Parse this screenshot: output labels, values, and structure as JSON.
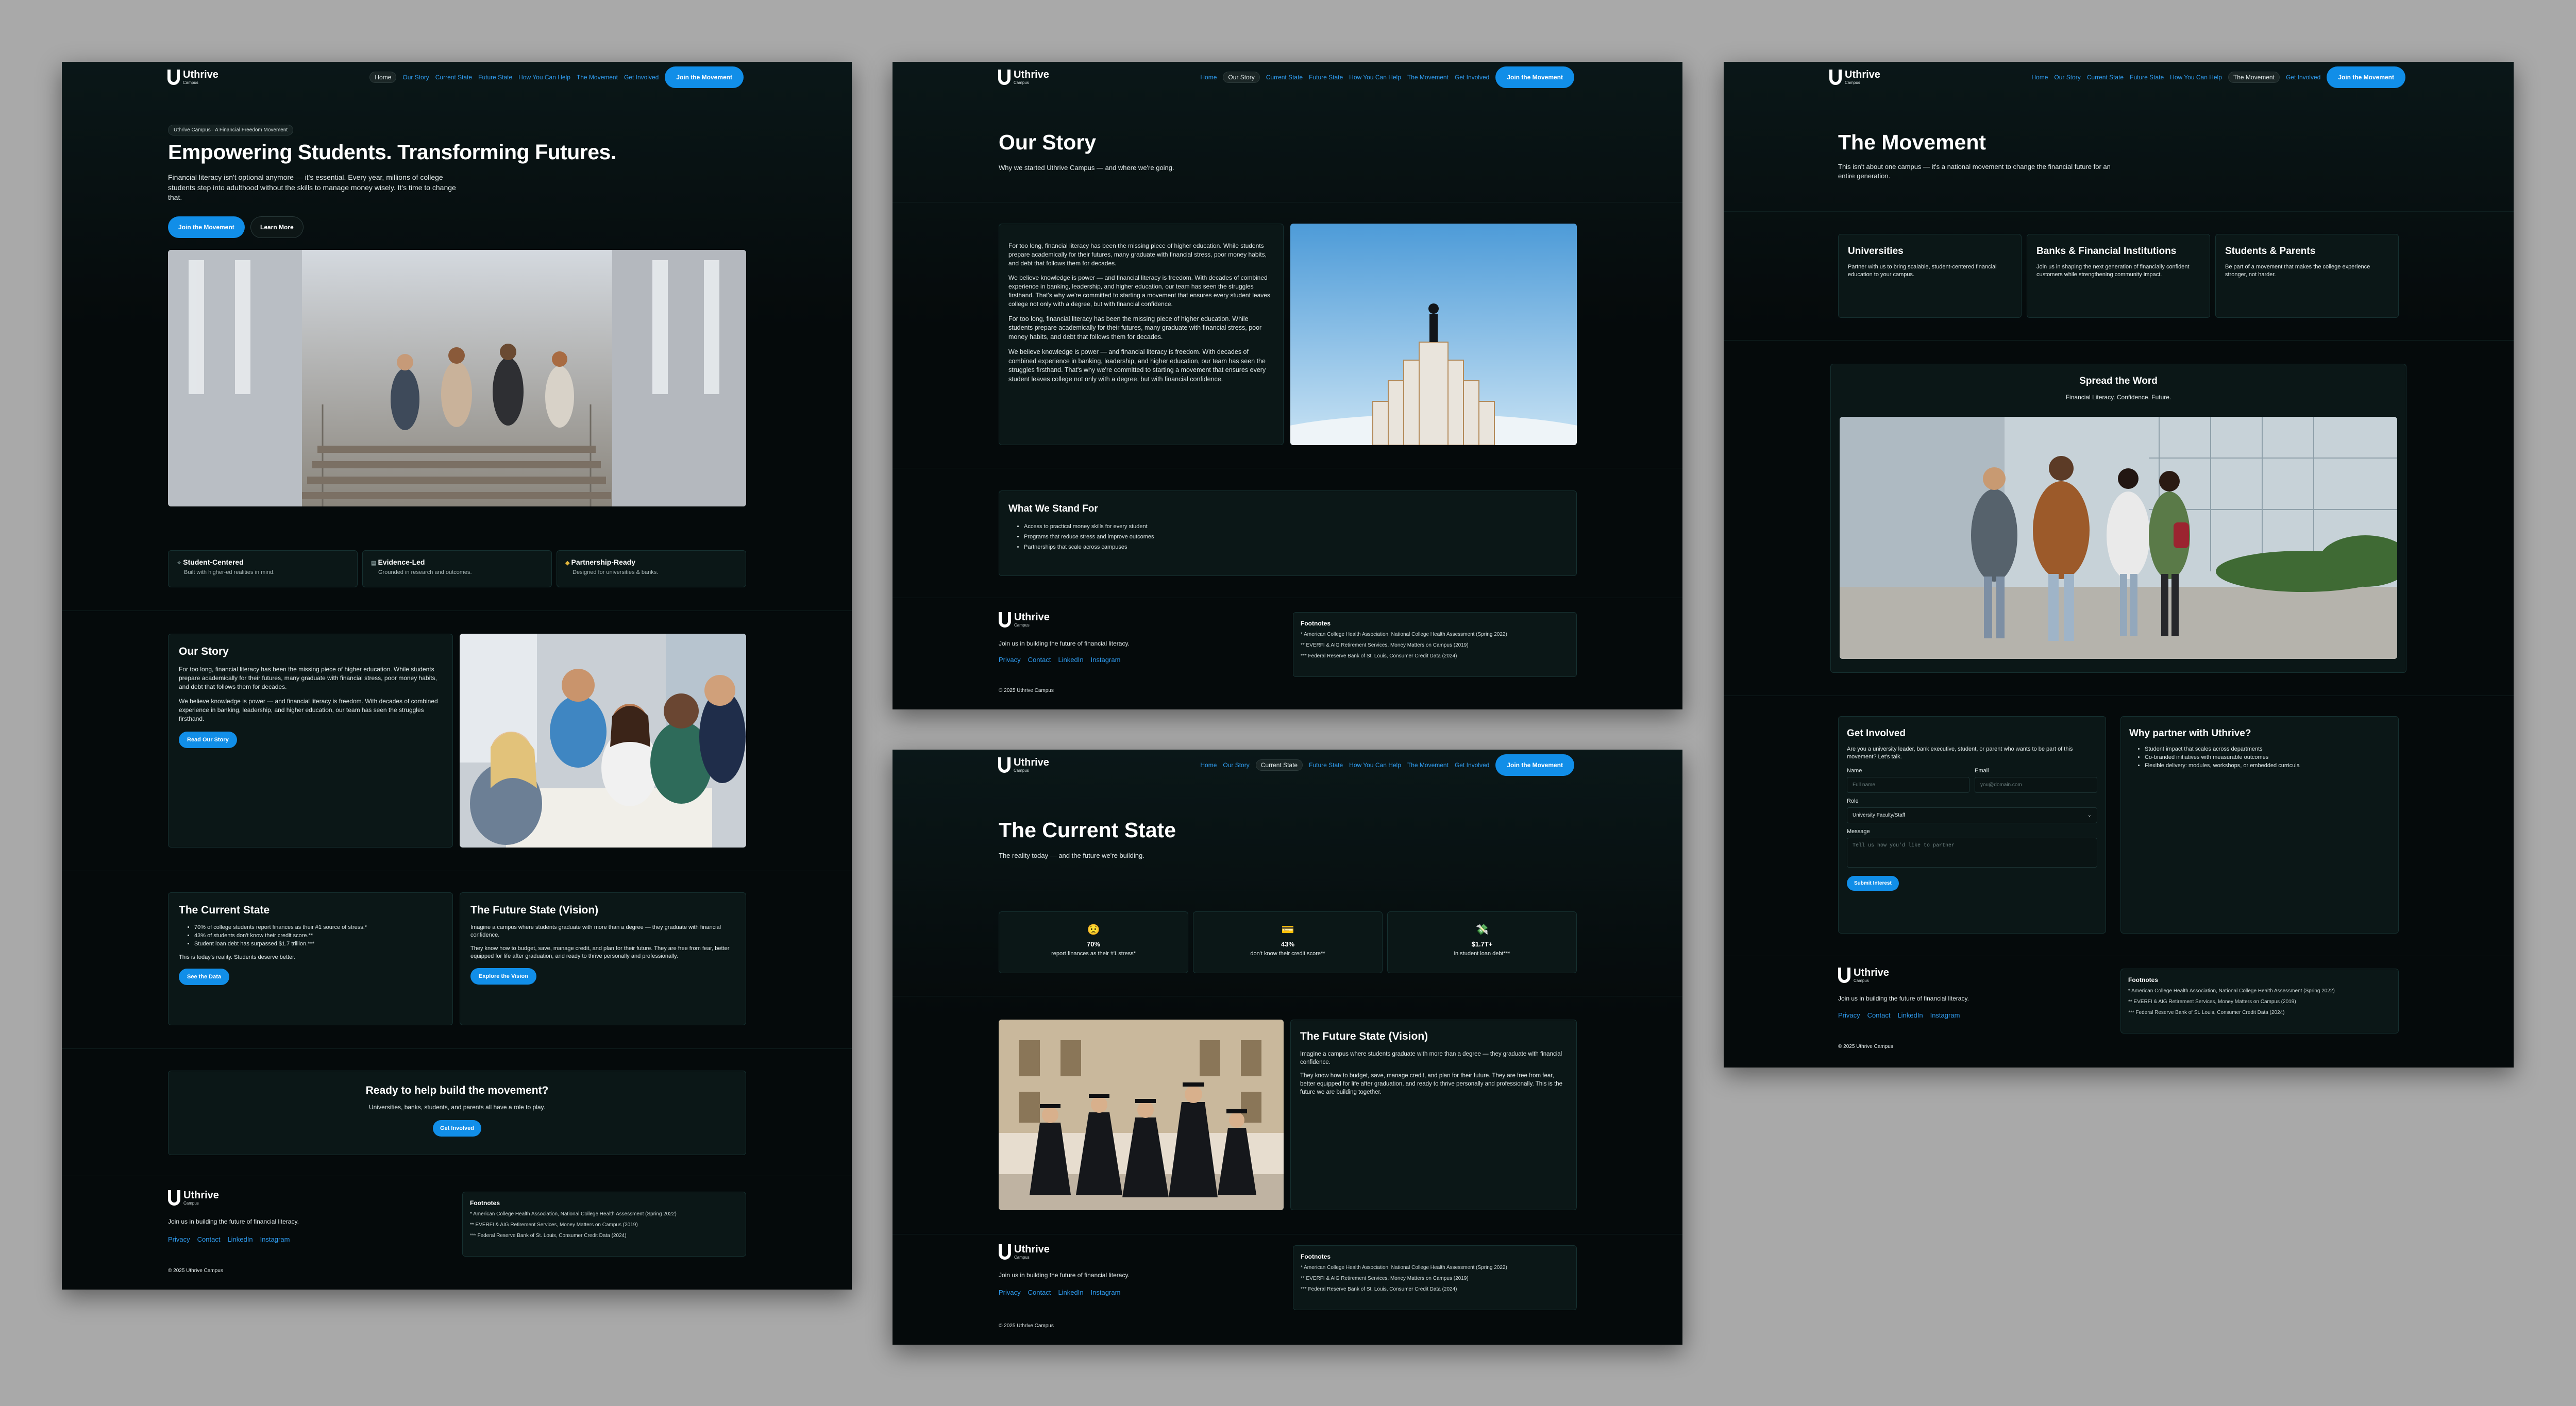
{
  "brand": {
    "name": "Uthrive",
    "sub": "Campus"
  },
  "nav": {
    "home": "Home",
    "story": "Our Story",
    "current": "Current State",
    "future": "Future State",
    "help": "How You Can Help",
    "movement": "The Movement",
    "involved": "Get Involved",
    "cta": "Join the Movement"
  },
  "footer": {
    "tagline": "Join us in building the future of financial literacy.",
    "privacy": "Privacy",
    "contact": "Contact",
    "linkedin": "LinkedIn",
    "instagram": "Instagram",
    "copyright": "© 2025 Uthrive Campus",
    "footnotes_title": "Footnotes",
    "fn1": "* American College Health Association, National College Health Assessment (Spring 2022)",
    "fn2": "** EVERFI & AIG Retirement Services, Money Matters on Campus (2019)",
    "fn3": "*** Federal Reserve Bank of St. Louis, Consumer Credit Data (2024)"
  },
  "home": {
    "badge": "Uthrive Campus · A Financial Freedom Movement",
    "title": "Empowering Students. Transforming Futures.",
    "lead": "Financial literacy isn't optional anymore — it's essential. Every year, millions of college students step into adulthood without the skills to manage money wisely. It's time to change that.",
    "btn_join": "Join the Movement",
    "btn_learn": "Learn More",
    "features": [
      {
        "title": "Student-Centered",
        "text": "Built with higher-ed realities in mind."
      },
      {
        "title": "Evidence-Led",
        "text": "Grounded in research and outcomes."
      },
      {
        "title": "Partnership-Ready",
        "text": "Designed for universities & banks."
      }
    ],
    "story_title": "Our Story",
    "story_p1": "For too long, financial literacy has been the missing piece of higher education. While students prepare academically for their futures, many graduate with financial stress, poor money habits, and debt that follows them for decades.",
    "story_p2": "We believe knowledge is power — and financial literacy is freedom. With decades of combined experience in banking, leadership, and higher education, our team has seen the struggles firsthand.",
    "story_btn": "Read Our Story",
    "current_title": "The Current State",
    "current_items": [
      "70% of college students report finances as their #1 source of stress.*",
      "43% of students don't know their credit score.**",
      "Student loan debt has surpassed $1.7 trillion.***"
    ],
    "current_note": "This is today's reality. Students deserve better.",
    "current_btn": "See the Data",
    "future_title": "The Future State (Vision)",
    "future_p1": "Imagine a campus where students graduate with more than a degree — they graduate with financial confidence.",
    "future_p2": "They know how to budget, save, manage credit, and plan for their future. They are free from fear, better equipped for life after graduation, and ready to thrive personally and professionally.",
    "future_btn": "Explore the Vision",
    "cta_title": "Ready to help build the movement?",
    "cta_text": "Universities, banks, students, and parents all have a role to play.",
    "cta_btn": "Get Involved"
  },
  "story": {
    "title": "Our Story",
    "subtitle": "Why we started Uthrive Campus — and where we're going.",
    "p1": "For too long, financial literacy has been the missing piece of higher education. While students prepare academically for their futures, many graduate with financial stress, poor money habits, and debt that follows them for decades.",
    "p2": "We believe knowledge is power — and financial literacy is freedom. With decades of combined experience in banking, leadership, and higher education, our team has seen the struggles firsthand. That's why we're committed to starting a movement that ensures every student leaves college not only with a degree, but with financial confidence.",
    "p3": "For too long, financial literacy has been the missing piece of higher education. While students prepare academically for their futures, many graduate with financial stress, poor money habits, and debt that follows them for decades.",
    "p4": "We believe knowledge is power — and financial literacy is freedom. With decades of combined experience in banking, leadership, and higher education, our team has seen the struggles firsthand. That's why we're committed to starting a movement that ensures every student leaves college not only with a degree, but with financial confidence.",
    "stand_title": "What We Stand For",
    "stand_items": [
      "Access to practical money skills for every student",
      "Programs that reduce stress and improve outcomes",
      "Partnerships that scale across campuses"
    ]
  },
  "current": {
    "title": "The Current State",
    "subtitle": "The reality today — and the future we're building.",
    "stats": [
      {
        "icon": "😟",
        "value": "70%",
        "label": "report finances as their #1 stress*"
      },
      {
        "icon": "💳",
        "value": "43%",
        "label": "don't know their credit score**"
      },
      {
        "icon": "💸",
        "value": "$1.7T+",
        "label": "in student loan debt***"
      }
    ],
    "future_title": "The Future State (Vision)",
    "future_p1": "Imagine a campus where students graduate with more than a degree — they graduate with financial confidence.",
    "future_p2": "They know how to budget, save, manage credit, and plan for their future. They are free from fear, better equipped for life after graduation, and ready to thrive personally and professionally. This is the future we are building together."
  },
  "movement": {
    "title": "The Movement",
    "subtitle": "This isn't about one campus — it's a national movement to change the financial future for an entire generation.",
    "cards": [
      {
        "title": "Universities",
        "text": "Partner with us to bring scalable, student-centered financial education to your campus."
      },
      {
        "title": "Banks & Financial Institutions",
        "text": "Join us in shaping the next generation of financially confident customers while strengthening community impact."
      },
      {
        "title": "Students & Parents",
        "text": "Be part of a movement that makes the college experience stronger, not harder."
      }
    ],
    "spread_title": "Spread the Word",
    "spread_sub": "Financial Literacy. Confidence. Future.",
    "involved_title": "Get Involved",
    "involved_text": "Are you a university leader, bank executive, student, or parent who wants to be part of this movement? Let's talk.",
    "name_label": "Name",
    "name_ph": "Full name",
    "email_label": "Email",
    "email_ph": "you@domain.com",
    "role_label": "Role",
    "role_value": "University Faculty/Staff",
    "message_label": "Message",
    "message_ph": "Tell us how you'd like to partner",
    "submit": "Submit Interest",
    "why_title": "Why partner with Uthrive?",
    "why_items": [
      "Student impact that scales across departments",
      "Co-branded initiatives with measurable outcomes",
      "Flexible delivery: modules, workshops, or embedded curricula"
    ]
  }
}
